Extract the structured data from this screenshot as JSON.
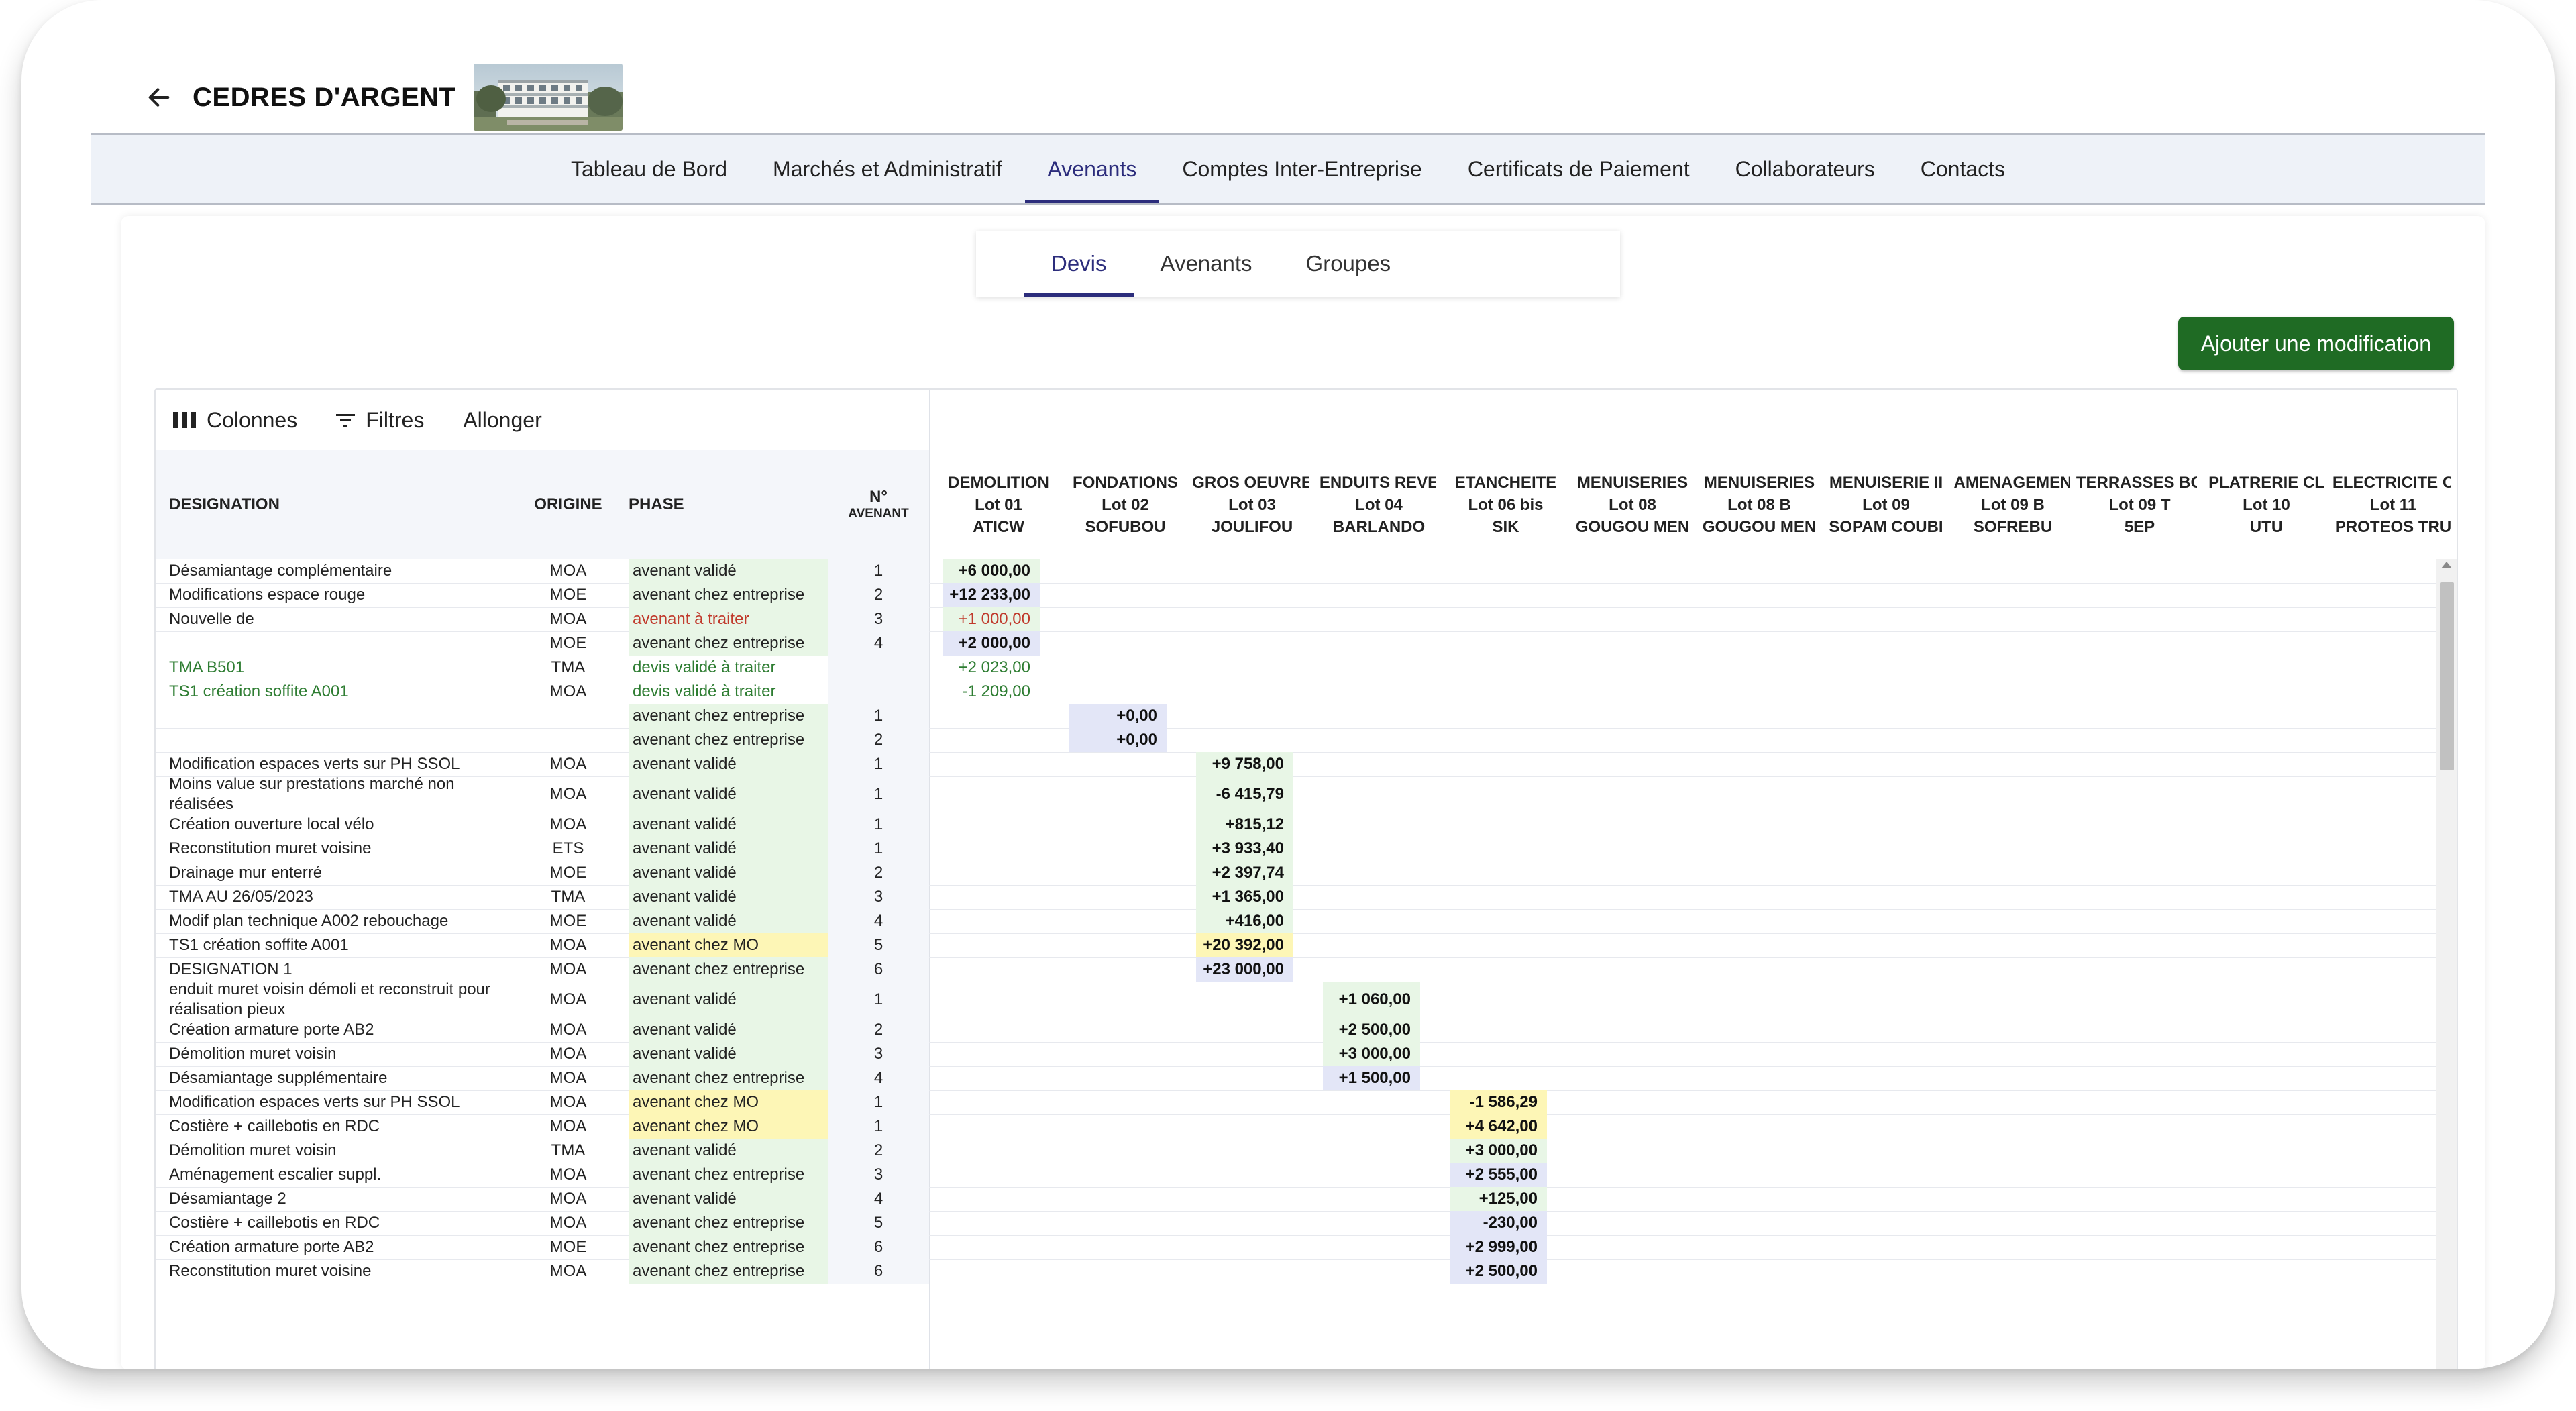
{
  "project": {
    "title": "CEDRES D'ARGENT"
  },
  "main_tabs": [
    {
      "label": "Tableau de Bord"
    },
    {
      "label": "Marchés et Administratif"
    },
    {
      "label": "Avenants"
    },
    {
      "label": "Comptes Inter-Entreprise"
    },
    {
      "label": "Certificats de Paiement"
    },
    {
      "label": "Collaborateurs"
    },
    {
      "label": "Contacts"
    }
  ],
  "main_active_tab": "Avenants",
  "sub_tabs": [
    {
      "label": "Devis"
    },
    {
      "label": "Avenants"
    },
    {
      "label": "Groupes"
    }
  ],
  "sub_active_tab": "Devis",
  "add_button_label": "Ajouter une modification",
  "toolbar": {
    "columns_label": "Colonnes",
    "filters_label": "Filtres",
    "expand_label": "Allonger"
  },
  "columns": {
    "designation": "DESIGNATION",
    "origin": "ORIGINE",
    "phase": "PHASE",
    "num_line1": "N°",
    "num_line2": "AVENANT"
  },
  "lots": [
    {
      "name": "DEMOLITION",
      "lot": "Lot 01",
      "company": "ATICW"
    },
    {
      "name": "FONDATIONS",
      "lot": "Lot 02",
      "company": "SOFUBOU"
    },
    {
      "name": "GROS OEUVRE",
      "lot": "Lot 03",
      "company": "JOULIFOU"
    },
    {
      "name": "ENDUITS REVE",
      "lot": "Lot 04",
      "company": "BARLANDO"
    },
    {
      "name": "ETANCHEITE",
      "lot": "Lot 06 bis",
      "company": "SIK"
    },
    {
      "name": "MENUISERIES",
      "lot": "Lot 08",
      "company": "GOUGOU MEN"
    },
    {
      "name": "MENUISERIES",
      "lot": "Lot 08 B",
      "company": "GOUGOU MEN"
    },
    {
      "name": "MENUISERIE II",
      "lot": "Lot 09",
      "company": "SOPAM COUBI"
    },
    {
      "name": "AMENAGEMEN",
      "lot": "Lot 09 B",
      "company": "SOFREBU"
    },
    {
      "name": "TERRASSES BO",
      "lot": "Lot 09 T",
      "company": "5EP"
    },
    {
      "name": "PLATRERIE CL",
      "lot": "Lot 10",
      "company": "UTU"
    },
    {
      "name": "ELECTRICITE C",
      "lot": "Lot 11",
      "company": "PROTEOS TRU"
    }
  ],
  "phase_styles": {
    "avenant validé": {
      "bg": "#e8f6e6",
      "color": "#222222"
    },
    "avenant chez entreprise": {
      "bg": "#e8f6e6",
      "color": "#222222"
    },
    "avenant à traiter": {
      "bg": "#e8f6e6",
      "color": "#c0392b"
    },
    "devis validé à traiter": {
      "bg": "#ffffff",
      "color": "#2e7d32"
    },
    "avenant chez MO": {
      "bg": "#fdf6b6",
      "color": "#222222"
    }
  },
  "value_styles": {
    "green": {
      "bg": "#e8f6e6",
      "color": "#111111",
      "bold": true
    },
    "red": {
      "bg": "#e8f6e6",
      "color": "#c0392b",
      "bold": false
    },
    "blue": {
      "bg": "#e3e6f7",
      "color": "#111111",
      "bold": true
    },
    "yellow": {
      "bg": "#fdf6b6",
      "color": "#111111",
      "bold": true
    },
    "plain": {
      "bg": "#ffffff",
      "color": "#2e7d32",
      "bold": false
    }
  },
  "rows": [
    {
      "designation": "Désamiantage complémentaire",
      "origin": "MOA",
      "phase": "avenant validé",
      "num": "1",
      "lot": 0,
      "value": "+6 000,00",
      "vstyle": "green"
    },
    {
      "designation": "Modifications espace rouge",
      "origin": "MOE",
      "phase": "avenant chez entreprise",
      "num": "2",
      "lot": 0,
      "value": "+12 233,00",
      "vstyle": "blue"
    },
    {
      "designation": "Nouvelle de",
      "origin": "MOA",
      "phase": "avenant à traiter",
      "num": "3",
      "lot": 0,
      "value": "+1 000,00",
      "vstyle": "red"
    },
    {
      "designation": "",
      "origin": "MOE",
      "phase": "avenant chez entreprise",
      "num": "4",
      "lot": 0,
      "value": "+2 000,00",
      "vstyle": "blue"
    },
    {
      "designation": "TMA B501",
      "origin": "TMA",
      "phase": "devis validé à traiter",
      "num": "",
      "lot": 0,
      "value": "+2 023,00",
      "vstyle": "plain",
      "green_text": true
    },
    {
      "designation": "TS1 création soffite A001",
      "origin": "MOA",
      "phase": "devis validé à traiter",
      "num": "",
      "lot": 0,
      "value": "-1 209,00",
      "vstyle": "plain",
      "green_text": true
    },
    {
      "designation": "",
      "origin": "",
      "phase": "avenant chez entreprise",
      "num": "1",
      "lot": 1,
      "value": "+0,00",
      "vstyle": "blue"
    },
    {
      "designation": "",
      "origin": "",
      "phase": "avenant chez entreprise",
      "num": "2",
      "lot": 1,
      "value": "+0,00",
      "vstyle": "blue"
    },
    {
      "designation": "Modification espaces verts sur PH SSOL",
      "origin": "MOA",
      "phase": "avenant validé",
      "num": "1",
      "lot": 2,
      "value": "+9 758,00",
      "vstyle": "green"
    },
    {
      "designation": "Moins value sur prestations marché non réalisées",
      "origin": "MOA",
      "phase": "avenant validé",
      "num": "1",
      "lot": 2,
      "value": "-6 415,79",
      "vstyle": "green",
      "tall": true
    },
    {
      "designation": "Création ouverture local vélo",
      "origin": "MOA",
      "phase": "avenant validé",
      "num": "1",
      "lot": 2,
      "value": "+815,12",
      "vstyle": "green"
    },
    {
      "designation": "Reconstitution muret voisine",
      "origin": "ETS",
      "phase": "avenant validé",
      "num": "1",
      "lot": 2,
      "value": "+3 933,40",
      "vstyle": "green"
    },
    {
      "designation": "Drainage mur enterré",
      "origin": "MOE",
      "phase": "avenant validé",
      "num": "2",
      "lot": 2,
      "value": "+2 397,74",
      "vstyle": "green"
    },
    {
      "designation": "TMA AU 26/05/2023",
      "origin": "TMA",
      "phase": "avenant validé",
      "num": "3",
      "lot": 2,
      "value": "+1 365,00",
      "vstyle": "green"
    },
    {
      "designation": "Modif plan technique A002 rebouchage",
      "origin": "MOE",
      "phase": "avenant validé",
      "num": "4",
      "lot": 2,
      "value": "+416,00",
      "vstyle": "green"
    },
    {
      "designation": "TS1 création soffite A001",
      "origin": "MOA",
      "phase": "avenant chez MO",
      "num": "5",
      "lot": 2,
      "value": "+20 392,00",
      "vstyle": "yellow"
    },
    {
      "designation": "DESIGNATION 1",
      "origin": "MOA",
      "phase": "avenant chez entreprise",
      "num": "6",
      "lot": 2,
      "value": "+23 000,00",
      "vstyle": "blue"
    },
    {
      "designation": "enduit muret voisin démoli et reconstruit pour réalisation pieux",
      "origin": "MOA",
      "phase": "avenant validé",
      "num": "1",
      "lot": 3,
      "value": "+1 060,00",
      "vstyle": "green",
      "tall": true
    },
    {
      "designation": "Création armature porte AB2",
      "origin": "MOA",
      "phase": "avenant validé",
      "num": "2",
      "lot": 3,
      "value": "+2 500,00",
      "vstyle": "green"
    },
    {
      "designation": "Démolition muret voisin",
      "origin": "MOA",
      "phase": "avenant validé",
      "num": "3",
      "lot": 3,
      "value": "+3 000,00",
      "vstyle": "green"
    },
    {
      "designation": "Désamiantage supplémentaire",
      "origin": "MOA",
      "phase": "avenant chez entreprise",
      "num": "4",
      "lot": 3,
      "value": "+1 500,00",
      "vstyle": "blue"
    },
    {
      "designation": "Modification espaces verts sur PH SSOL",
      "origin": "MOA",
      "phase": "avenant chez MO",
      "num": "1",
      "lot": 4,
      "value": "-1 586,29",
      "vstyle": "yellow"
    },
    {
      "designation": "Costière + caillebotis en RDC",
      "origin": "MOA",
      "phase": "avenant chez MO",
      "num": "1",
      "lot": 4,
      "value": "+4 642,00",
      "vstyle": "yellow"
    },
    {
      "designation": "Démolition muret voisin",
      "origin": "TMA",
      "phase": "avenant validé",
      "num": "2",
      "lot": 4,
      "value": "+3 000,00",
      "vstyle": "green"
    },
    {
      "designation": "Aménagement escalier suppl.",
      "origin": "MOA",
      "phase": "avenant chez entreprise",
      "num": "3",
      "lot": 4,
      "value": "+2 555,00",
      "vstyle": "blue"
    },
    {
      "designation": "Désamiantage 2",
      "origin": "MOA",
      "phase": "avenant validé",
      "num": "4",
      "lot": 4,
      "value": "+125,00",
      "vstyle": "green"
    },
    {
      "designation": "Costière + caillebotis en RDC",
      "origin": "MOA",
      "phase": "avenant chez entreprise",
      "num": "5",
      "lot": 4,
      "value": "-230,00",
      "vstyle": "blue"
    },
    {
      "designation": "Création armature porte AB2",
      "origin": "MOE",
      "phase": "avenant chez entreprise",
      "num": "6",
      "lot": 4,
      "value": "+2 999,00",
      "vstyle": "blue"
    },
    {
      "designation": "Reconstitution muret voisine",
      "origin": "MOA",
      "phase": "avenant chez entreprise",
      "num": "6",
      "lot": 4,
      "value": "+2 500,00",
      "vstyle": "blue"
    }
  ]
}
